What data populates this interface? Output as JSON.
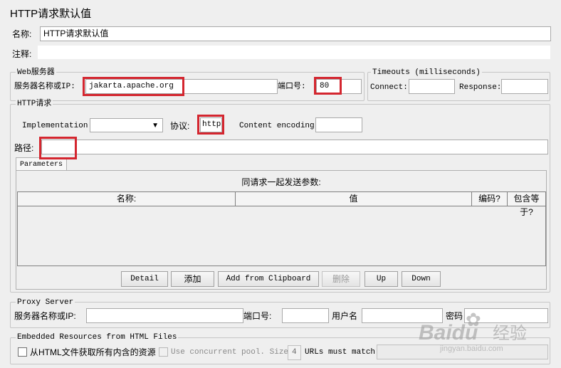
{
  "panel_title": "HTTP请求默认值",
  "name": {
    "label": "名称:",
    "value": "HTTP请求默认值"
  },
  "comment": {
    "label": "注释:",
    "value": ""
  },
  "web_server": {
    "legend": "Web服务器",
    "server_label": "服务器名称或IP:",
    "server_value": "jakarta.apache.org",
    "port_label": "端口号:",
    "port_value": "80"
  },
  "timeouts": {
    "legend": "Timeouts (milliseconds)",
    "connect_label": "Connect:",
    "connect_value": "",
    "response_label": "Response:",
    "response_value": ""
  },
  "http_request": {
    "legend": "HTTP请求",
    "implementation_label": "Implementation:",
    "implementation_value": "",
    "protocol_label": "协议:",
    "protocol_value": "http",
    "encoding_label": "Content encoding:",
    "encoding_value": "",
    "path_label": "路径:",
    "path_value": ""
  },
  "parameters": {
    "tab_label": "Parameters",
    "caption": "同请求一起发送参数:",
    "columns": [
      "名称:",
      "值",
      "编码?",
      "包含等于?"
    ],
    "rows": [],
    "buttons": {
      "detail": "Detail",
      "add": "添加",
      "add_clipboard": "Add from Clipboard",
      "delete": "删除",
      "up": "Up",
      "down": "Down"
    }
  },
  "proxy": {
    "legend": "Proxy Server",
    "server_label": "服务器名称或IP:",
    "server_value": "",
    "port_label": "端口号:",
    "port_value": "",
    "user_label": "用户名",
    "user_value": "",
    "password_label": "密码",
    "password_value": ""
  },
  "embedded": {
    "legend": "Embedded Resources from HTML Files",
    "retrieve_label": "从HTML文件获取所有内含的资源",
    "retrieve_checked": false,
    "concurrent_label": "Use concurrent pool. Size:",
    "concurrent_checked": false,
    "pool_size": "4",
    "urls_match_label": "URLs must match:",
    "urls_match_value": ""
  },
  "watermark": {
    "brand": "Baidu",
    "product": "经验",
    "site": "jingyan.baidu.com"
  },
  "colors": {
    "highlight": "#d4262f",
    "background": "#efefef"
  }
}
